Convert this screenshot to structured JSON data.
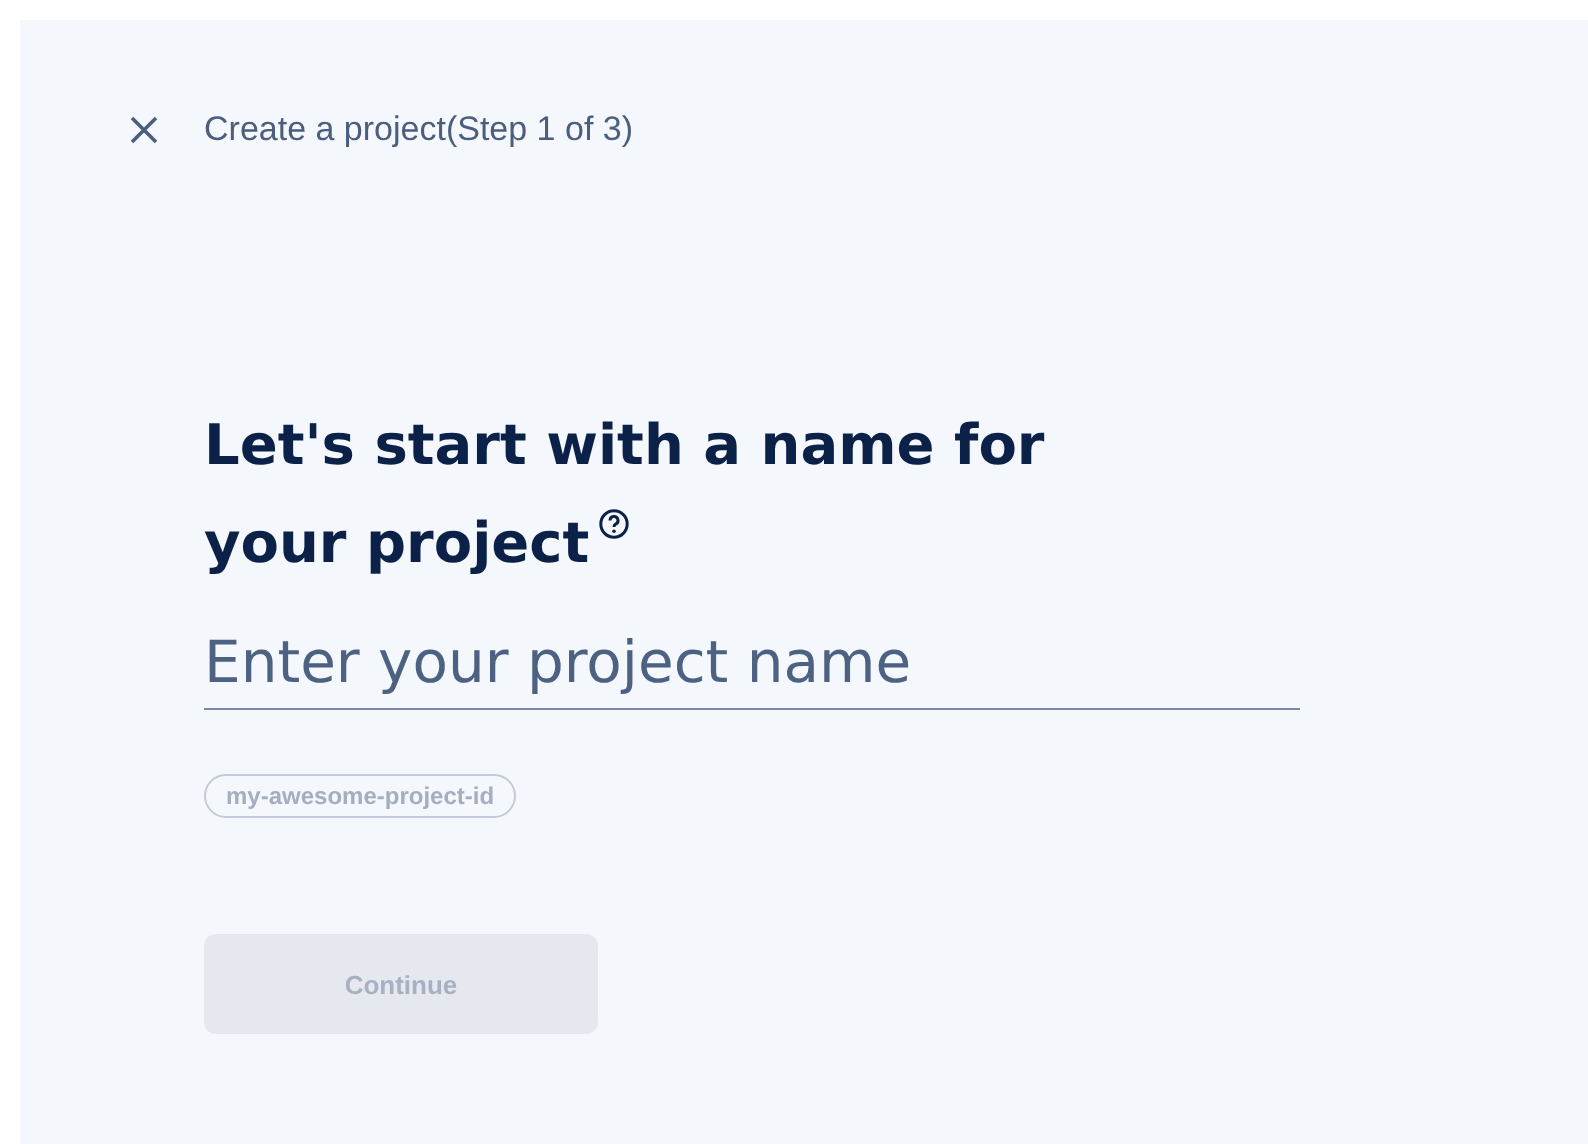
{
  "header": {
    "title": "Create a project(Step 1 of 3)"
  },
  "heading": {
    "lines": [
      "Let's start with a name for",
      "your project"
    ]
  },
  "name_field": {
    "placeholder": "Enter your project name"
  },
  "project_id": "my-awesome-project-id",
  "continue_button": {
    "label": "Continue",
    "disabled": true
  }
}
